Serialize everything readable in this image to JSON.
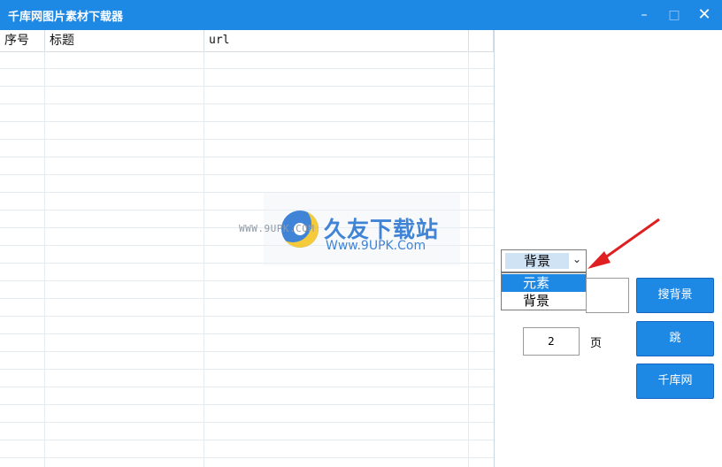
{
  "window": {
    "title": "千库网图片素材下载器",
    "minimize_glyph": "–",
    "maximize_glyph": "□",
    "close_glyph": "✕"
  },
  "table": {
    "columns": [
      "序号",
      "标题",
      "url"
    ],
    "rows": []
  },
  "watermark": {
    "site": "WWW.9UPK.COM",
    "name": "久友下载站",
    "url": "Www.9UPK.Com"
  },
  "category_select": {
    "selected": "背景",
    "arrow_glyph": "⌄",
    "options": [
      "元素",
      "背景"
    ],
    "highlighted_option": "元素"
  },
  "keyword_input": {
    "value": ""
  },
  "page": {
    "value": "2",
    "label": "页"
  },
  "buttons": {
    "search": "搜背景",
    "jump": "跳",
    "site": "千库网"
  },
  "colors": {
    "titlebar": "#1e88e5",
    "button": "#1e88e5",
    "highlight": "#1e88e5",
    "annotation_arrow": "#e02020"
  },
  "icons": [
    "minimize-icon",
    "maximize-icon",
    "close-icon",
    "dropdown-arrow-icon",
    "watermark-logo-icon",
    "annotation-arrow"
  ]
}
